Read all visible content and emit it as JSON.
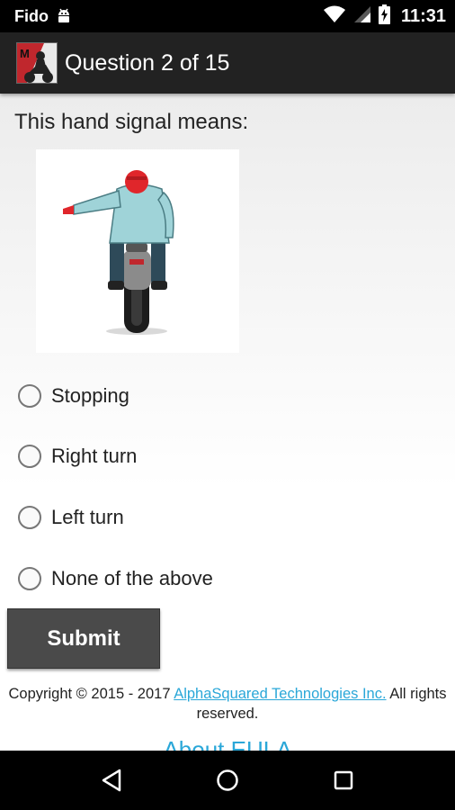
{
  "status_bar": {
    "carrier": "Fido",
    "time": "11:31",
    "icons": [
      "android-notification-icon",
      "wifi-icon",
      "cell-signal-icon",
      "battery-charging-icon"
    ]
  },
  "action_bar": {
    "app_icon": "motorcycle-app-icon",
    "title": "Question 2 of 15"
  },
  "question": {
    "prompt": "This hand signal means:",
    "image": "motorcyclist-hand-signal-left-arm-extended",
    "options": [
      {
        "label": "Stopping",
        "selected": false
      },
      {
        "label": "Right turn",
        "selected": false
      },
      {
        "label": "Left turn",
        "selected": false
      },
      {
        "label": "None of the above",
        "selected": false
      }
    ]
  },
  "submit": {
    "label": "Submit"
  },
  "footer": {
    "copyright_prefix": "Copyright © 2015 - 2017 ",
    "company_link": "AlphaSquared Technologies Inc.",
    "copyright_suffix": " All rights reserved.",
    "links_partial": "About EULA"
  },
  "nav_bar": {
    "icons": [
      "back-icon",
      "home-icon",
      "recents-icon"
    ]
  },
  "colors": {
    "action_bar": "#222222",
    "submit_button": "#4a4a4a",
    "link": "#2aa7d8"
  }
}
